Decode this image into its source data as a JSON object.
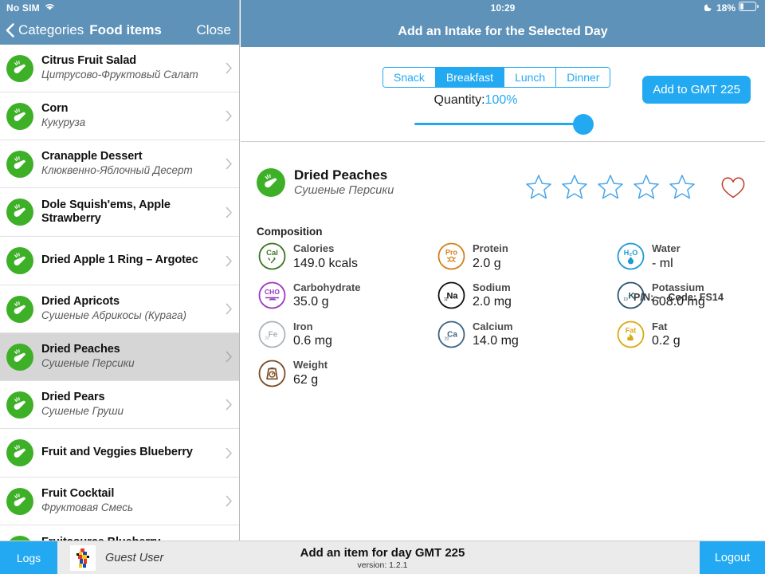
{
  "status_bar": {
    "carrier": "No SIM",
    "wifi_icon": "wifi-icon",
    "time": "10:29",
    "dnd_icon": "moon-icon",
    "battery_percent": "18%",
    "battery_icon": "battery-icon"
  },
  "sidebar": {
    "back_label": "Categories",
    "back_icon": "chevron-left-icon",
    "title": "Food items",
    "close_label": "Close",
    "items": [
      {
        "name": "Citrus Fruit Salad",
        "sub": "Цитрусово-Фруктовый Салат",
        "icon": "vegetable-icon",
        "selected": false
      },
      {
        "name": "Corn",
        "sub": "Кукуруза",
        "icon": "vegetable-icon",
        "selected": false
      },
      {
        "name": "Cranapple Dessert",
        "sub": "Клюквенно-Яблочный Десерт",
        "icon": "vegetable-icon",
        "selected": false
      },
      {
        "name": "Dole Squish'ems, Apple Strawberry",
        "sub": "",
        "icon": "vegetable-icon",
        "selected": false
      },
      {
        "name": "Dried Apple 1 Ring – Argotec",
        "sub": "",
        "icon": "vegetable-icon",
        "selected": false
      },
      {
        "name": "Dried Apricots",
        "sub": "Сушеные Абрикосы (Курага)",
        "icon": "vegetable-icon",
        "selected": false
      },
      {
        "name": "Dried Peaches",
        "sub": "Сушеные Персики",
        "icon": "vegetable-icon",
        "selected": true
      },
      {
        "name": "Dried Pears",
        "sub": "Сушеные Груши",
        "icon": "vegetable-icon",
        "selected": false
      },
      {
        "name": "Fruit and Veggies Blueberry",
        "sub": "",
        "icon": "vegetable-icon",
        "selected": false
      },
      {
        "name": "Fruit Cocktail",
        "sub": "Фруктовая Смесь",
        "icon": "vegetable-icon",
        "selected": false
      },
      {
        "name": "Fruitsource Blueberry Pomegranate",
        "sub": "",
        "icon": "vegetable-icon",
        "selected": false
      }
    ]
  },
  "main": {
    "title": "Add an Intake for the Selected Day",
    "meal_tabs": [
      {
        "label": "Snack",
        "active": false
      },
      {
        "label": "Breakfast",
        "active": true
      },
      {
        "label": "Lunch",
        "active": false
      },
      {
        "label": "Dinner",
        "active": false
      }
    ],
    "quantity_label": "Quantity:",
    "quantity_value": "100%",
    "slider_percent": 100,
    "add_button": "Add to GMT 225"
  },
  "detail": {
    "pn_label": "P/N: -",
    "code_label": "Code: FS14",
    "name": "Dried Peaches",
    "sub": "Сушеные Персики",
    "icon": "vegetable-icon",
    "rating": 0,
    "stars": 5,
    "favorite_icon": "heart-outline-icon",
    "composition_heading": "Composition",
    "nutrients": [
      {
        "label": "Calories",
        "value": "149.0 kcals",
        "icon": "calories-icon",
        "color": "#3b7521"
      },
      {
        "label": "Protein",
        "value": "2.0 g",
        "icon": "protein-icon",
        "color": "#d2801b"
      },
      {
        "label": "Water",
        "value": "- ml",
        "icon": "water-icon",
        "color": "#1b9ad6"
      },
      {
        "label": "Carbohydrate",
        "value": "35.0 g",
        "icon": "carbohydrate-icon",
        "color": "#9b36c4"
      },
      {
        "label": "Sodium",
        "value": "2.0 mg",
        "icon": "sodium-icon",
        "color": "#111111"
      },
      {
        "label": "Potassium",
        "value": "608.0 mg",
        "icon": "potassium-icon",
        "color": "#28536b"
      },
      {
        "label": "Iron",
        "value": "0.6 mg",
        "icon": "iron-icon",
        "color": "#adb4bb"
      },
      {
        "label": "Calcium",
        "value": "14.0 mg",
        "icon": "calcium-icon",
        "color": "#3d6382"
      },
      {
        "label": "Fat",
        "value": "0.2 g",
        "icon": "fat-icon",
        "color": "#d6aa12"
      },
      {
        "label": "Weight",
        "value": "62 g",
        "icon": "weight-icon",
        "color": "#7a4a22"
      }
    ]
  },
  "bottom_bar": {
    "logs_label": "Logs",
    "avatar_icon": "user-avatar",
    "user_name": "Guest User",
    "title": "Add an item for day GMT 225",
    "version": "version: 1.2.1",
    "logout_label": "Logout"
  },
  "colors": {
    "header_blue": "#5e92b9",
    "accent_blue": "#23a9f2",
    "selected_row": "#d6d6d6",
    "veg_green": "#3eb028",
    "heart_red": "#c0392b",
    "bottom_bar": "#ebebeb"
  }
}
